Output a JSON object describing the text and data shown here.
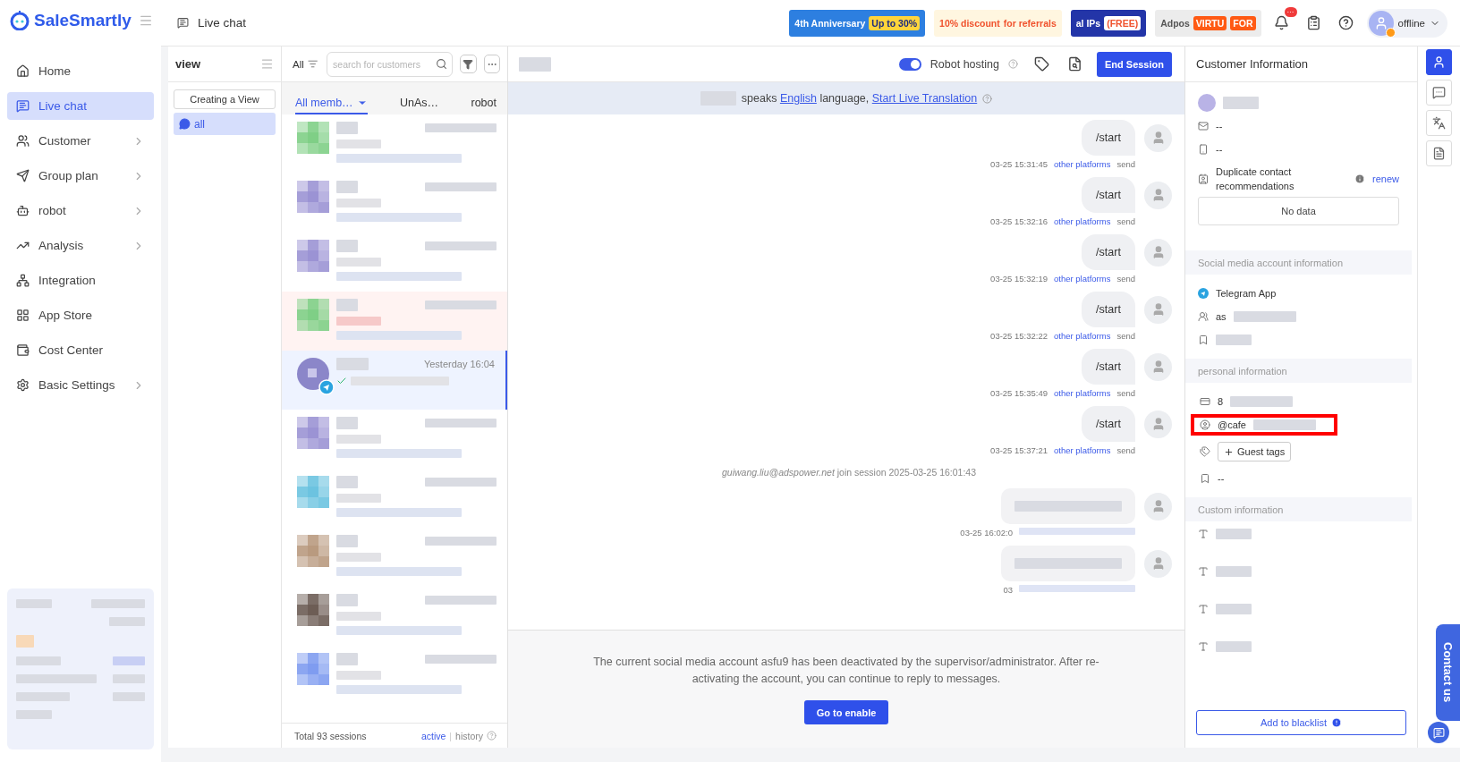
{
  "brand": {
    "name": "SaleSmartly"
  },
  "nav": [
    {
      "label": "Home",
      "selected": false,
      "arrow": false
    },
    {
      "label": "Live chat",
      "selected": true,
      "arrow": false
    },
    {
      "label": "Customer",
      "selected": false,
      "arrow": true
    },
    {
      "label": "Group plan",
      "selected": false,
      "arrow": true
    },
    {
      "label": "robot",
      "selected": false,
      "arrow": true
    },
    {
      "label": "Analysis",
      "selected": false,
      "arrow": true
    },
    {
      "label": "Integration",
      "selected": false,
      "arrow": false
    },
    {
      "label": "App Store",
      "selected": false,
      "arrow": false
    },
    {
      "label": "Cost Center",
      "selected": false,
      "arrow": false
    },
    {
      "label": "Basic Settings",
      "selected": false,
      "arrow": true
    }
  ],
  "header": {
    "title": "Live chat",
    "banners": [
      {
        "kind": "anniversary",
        "texts": [
          "4th Anniversary",
          "Up to 30%"
        ]
      },
      {
        "kind": "discount",
        "texts": [
          "10% discount",
          "for referrals"
        ]
      },
      {
        "kind": "ips",
        "texts": [
          "al IPs",
          "(FREE)"
        ]
      },
      {
        "kind": "virtual",
        "texts": [
          "Adpos",
          "VIRTU",
          "FOR"
        ]
      }
    ],
    "notification": "···",
    "status": "offline"
  },
  "views": {
    "title": "view",
    "create": "Creating a View",
    "items": [
      {
        "label": "all",
        "selected": true
      }
    ]
  },
  "list": {
    "filter": "All",
    "search_placeholder": "search for customers",
    "tabs": [
      {
        "label": "All memb…",
        "selected": true,
        "dropdown": true
      },
      {
        "label": "UnAs…",
        "selected": false,
        "dropdown": false
      },
      {
        "label": "robot",
        "selected": false,
        "dropdown": false
      }
    ],
    "sessions": [
      {
        "kind": "blurred",
        "color": "#7fcf86",
        "unread": false,
        "selected": false
      },
      {
        "kind": "blurred",
        "color": "#9b93d4",
        "unread": false,
        "selected": false
      },
      {
        "kind": "blurred",
        "color": "#9b93d4",
        "unread": false,
        "selected": false
      },
      {
        "kind": "blurred",
        "color": "#7fcf86",
        "unread": true,
        "selected": false
      },
      {
        "kind": "visible",
        "color": "#8b86c9",
        "time": "Yesterday 16:04",
        "unread": false,
        "selected": true
      },
      {
        "kind": "blurred",
        "color": "#9b93d4",
        "unread": false,
        "selected": false
      },
      {
        "kind": "blurred",
        "color": "#6cc3e0",
        "unread": false,
        "selected": false
      },
      {
        "kind": "blurred",
        "color": "#b99a7f",
        "unread": false,
        "selected": false
      },
      {
        "kind": "blurred",
        "color": "#6d5d55",
        "unread": false,
        "selected": false
      },
      {
        "kind": "blurred",
        "color": "#7f9cf0",
        "unread": false,
        "selected": false
      }
    ],
    "footer": {
      "total": "Total 93 sessions",
      "active": "active",
      "separator": "|",
      "history": "history"
    }
  },
  "chat": {
    "robot_hosting": {
      "label": "Robot hosting",
      "on": true
    },
    "end_button": "End Session",
    "translation": {
      "before": "speaks",
      "language": "English",
      "middle": "language,",
      "action": "Start Live Translation"
    },
    "messages": [
      {
        "kind": "text",
        "text": "/start",
        "time": "03-25 15:31:45",
        "platform": "other platforms",
        "status": "send"
      },
      {
        "kind": "text",
        "text": "/start",
        "time": "03-25 15:32:16",
        "platform": "other platforms",
        "status": "send"
      },
      {
        "kind": "text",
        "text": "/start",
        "time": "03-25 15:32:19",
        "platform": "other platforms",
        "status": "send"
      },
      {
        "kind": "text",
        "text": "/start",
        "time": "03-25 15:32:22",
        "platform": "other platforms",
        "status": "send"
      },
      {
        "kind": "text",
        "text": "/start",
        "time": "03-25 15:35:49",
        "platform": "other platforms",
        "status": "send"
      },
      {
        "kind": "text",
        "text": "/start",
        "time": "03-25 15:37:21",
        "platform": "other platforms",
        "status": "send"
      },
      {
        "kind": "event",
        "text": "*guiwang.liu@adspower.net* join session 2025-03-25 16:01:43"
      },
      {
        "kind": "blurred",
        "time": "03-25 16:02:0"
      },
      {
        "kind": "blurred",
        "time": "03"
      }
    ],
    "notice": {
      "text": "The current social media account asfu9 has been deactivated by the supervisor/administrator. After re-activating the account, you can continue to reply to messages.",
      "button": "Go to enable"
    }
  },
  "customer": {
    "title": "Customer Information",
    "email": "--",
    "phone": "--",
    "duplicate": {
      "label": "Duplicate contact recommendations",
      "action": "renew",
      "empty": "No data"
    },
    "sections": [
      {
        "title": "Social media account information",
        "rows": [
          {
            "kind": "value",
            "text": "Telegram App",
            "blurred": false,
            "highlighted": false
          },
          {
            "kind": "value",
            "text": "as",
            "blurred": true,
            "highlighted": false
          },
          {
            "kind": "value",
            "blurred": true,
            "highlighted": false
          }
        ]
      },
      {
        "title": "personal information",
        "rows": [
          {
            "kind": "value",
            "text": "8",
            "blurred": true,
            "highlighted": false
          },
          {
            "kind": "value",
            "text": "@cafe",
            "blurred": true,
            "highlighted": true
          },
          {
            "kind": "tags",
            "text": "Guest tags",
            "highlighted": false
          },
          {
            "kind": "value",
            "text": "--",
            "blurred": false,
            "highlighted": false
          }
        ]
      },
      {
        "title": "Custom information",
        "rows": [
          {
            "kind": "field",
            "blurred": true,
            "highlighted": false
          },
          {
            "kind": "field",
            "blurred": true,
            "highlighted": false
          },
          {
            "kind": "field",
            "blurred": true,
            "highlighted": false
          },
          {
            "kind": "field",
            "blurred": true,
            "highlighted": false
          }
        ]
      }
    ],
    "blacklist": "Add to blacklist"
  },
  "rail": [
    {
      "selected": true
    },
    {
      "selected": false
    },
    {
      "selected": false
    },
    {
      "selected": false
    }
  ],
  "contact": {
    "label": "Contact us"
  }
}
